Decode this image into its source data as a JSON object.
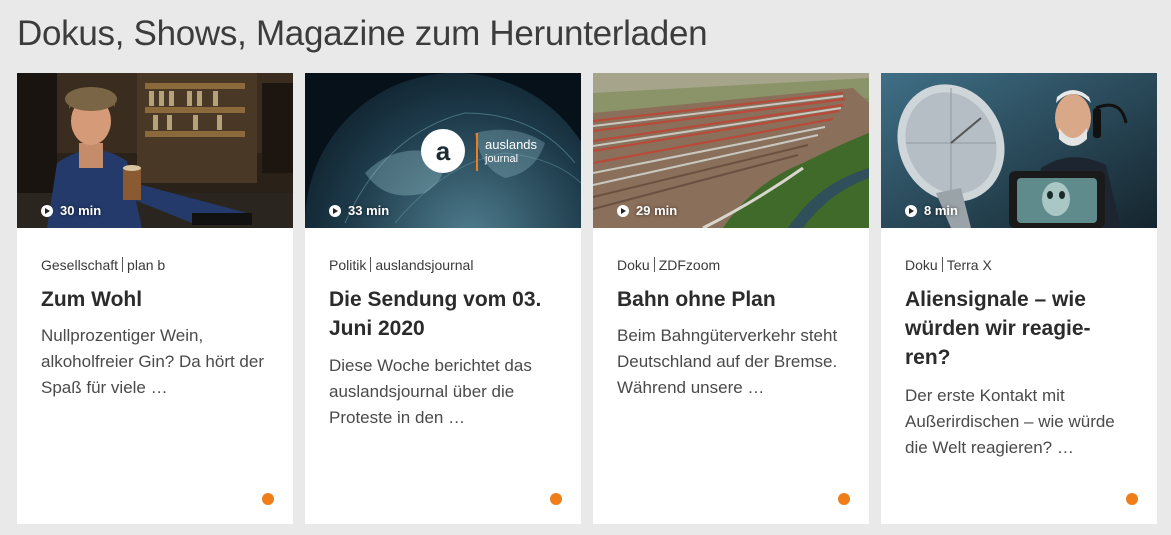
{
  "section": {
    "title": "Dokus, Shows, Magazine zum Herunterladen"
  },
  "colors": {
    "accent": "#f07d19",
    "background": "#e9e9e9"
  },
  "cards": [
    {
      "duration": "30 min",
      "category": "Gesellschaft",
      "series": "plan b",
      "title": "Zum Wohl",
      "description": "Nullprozentiger Wein, alkoholfreier Gin? Da hört der Spaß für viele …"
    },
    {
      "duration": "33 min",
      "category": "Politik",
      "series": "auslandsjournal",
      "title": "Die Sendung vom 03. Juni 2020",
      "description": "Diese Woche berichtet das auslandsjournal über die Proteste in den …",
      "logo_letter": "a",
      "logo_word1": "auslands",
      "logo_word2": "journal"
    },
    {
      "duration": "29 min",
      "category": "Doku",
      "series": "ZDFzoom",
      "title": "Bahn ohne Plan",
      "description": "Beim Bahngüterverkehr steht Deutschland auf der Bremse. Während unsere …"
    },
    {
      "duration": "8 min",
      "category": "Doku",
      "series": "Terra X",
      "title": "Aliensignale – wie würden wir reagie-ren?",
      "description": "Der erste Kontakt mit Außerirdischen – wie würde die Welt reagieren? …"
    }
  ]
}
